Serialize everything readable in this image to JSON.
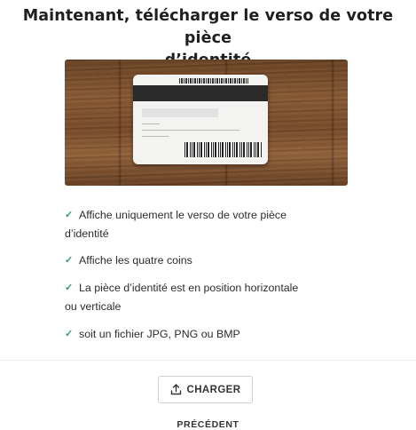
{
  "header": {
    "title_line1": "Maintenant, télécharger le verso de votre pièce",
    "title_line2": "d’identité"
  },
  "illustration": {
    "icon": "id-card-back-illustration"
  },
  "requirements": [
    {
      "line1": "Affiche uniquement le verso de votre pièce",
      "line2": "d’identité"
    },
    {
      "line1": "Affiche les quatre coins",
      "line2": ""
    },
    {
      "line1": "La pièce d’identité est en position horizontale",
      "line2": "ou verticale"
    },
    {
      "line1": "soit un fichier JPG, PNG ou BMP",
      "line2": ""
    }
  ],
  "actions": {
    "upload_label": "CHARGER",
    "upload_icon": "upload-icon",
    "back_label": "PRÉCÉDENT"
  },
  "colors": {
    "check": "#2ea06a",
    "text": "#2b2b2b"
  }
}
